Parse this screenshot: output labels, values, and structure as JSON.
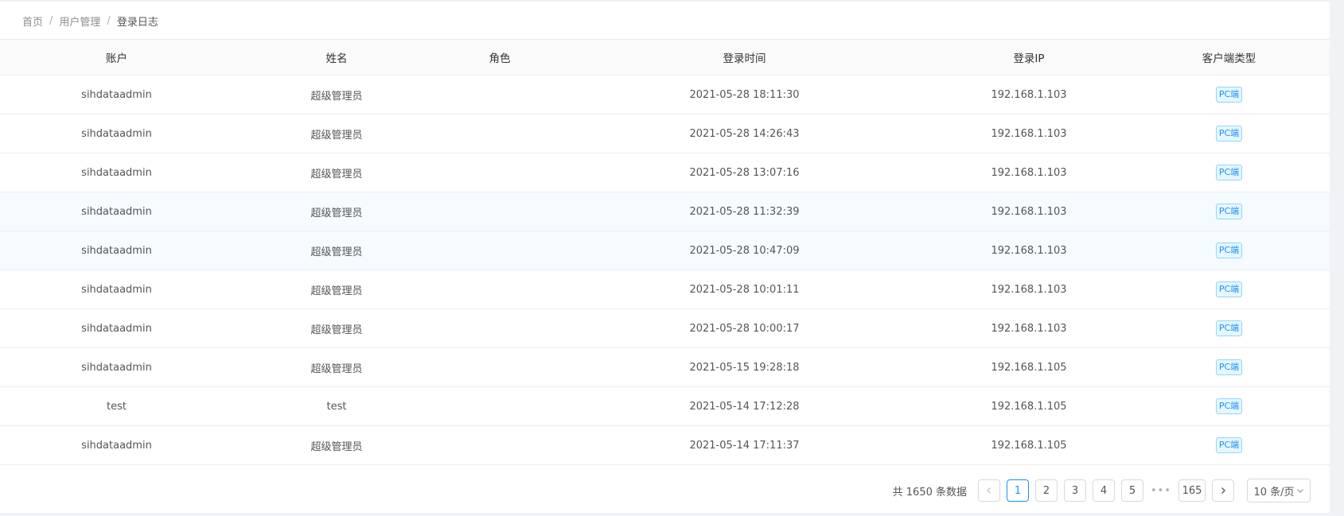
{
  "breadcrumb": {
    "items": [
      "首页",
      "用户管理",
      "登录日志"
    ],
    "separator": "/"
  },
  "table": {
    "columns": [
      "账户",
      "姓名",
      "角色",
      "登录时间",
      "登录IP",
      "客户端类型"
    ],
    "rows": [
      {
        "account": "sihdataadmin",
        "name": "超级管理员",
        "role": "",
        "time": "2021-05-28 18:11:30",
        "ip": "192.168.1.103",
        "client": "PC端"
      },
      {
        "account": "sihdataadmin",
        "name": "超级管理员",
        "role": "",
        "time": "2021-05-28 14:26:43",
        "ip": "192.168.1.103",
        "client": "PC端"
      },
      {
        "account": "sihdataadmin",
        "name": "超级管理员",
        "role": "",
        "time": "2021-05-28 13:07:16",
        "ip": "192.168.1.103",
        "client": "PC端"
      },
      {
        "account": "sihdataadmin",
        "name": "超级管理员",
        "role": "",
        "time": "2021-05-28 11:32:39",
        "ip": "192.168.1.103",
        "client": "PC端"
      },
      {
        "account": "sihdataadmin",
        "name": "超级管理员",
        "role": "",
        "time": "2021-05-28 10:47:09",
        "ip": "192.168.1.103",
        "client": "PC端"
      },
      {
        "account": "sihdataadmin",
        "name": "超级管理员",
        "role": "",
        "time": "2021-05-28 10:01:11",
        "ip": "192.168.1.103",
        "client": "PC端"
      },
      {
        "account": "sihdataadmin",
        "name": "超级管理员",
        "role": "",
        "time": "2021-05-28 10:00:17",
        "ip": "192.168.1.103",
        "client": "PC端"
      },
      {
        "account": "sihdataadmin",
        "name": "超级管理员",
        "role": "",
        "time": "2021-05-15 19:28:18",
        "ip": "192.168.1.105",
        "client": "PC端"
      },
      {
        "account": "test",
        "name": "test",
        "role": "",
        "time": "2021-05-14 17:12:28",
        "ip": "192.168.1.105",
        "client": "PC端"
      },
      {
        "account": "sihdataadmin",
        "name": "超级管理员",
        "role": "",
        "time": "2021-05-14 17:11:37",
        "ip": "192.168.1.105",
        "client": "PC端"
      }
    ],
    "highlighted_rows": [
      3,
      4
    ]
  },
  "pagination": {
    "total_text": "共 1650 条数据",
    "prev_icon": "chevron-left-icon",
    "next_icon": "chevron-right-icon",
    "pages": [
      "1",
      "2",
      "3",
      "4",
      "5"
    ],
    "current_page": "1",
    "ellipsis": "•••",
    "last_page": "165",
    "page_size": "10 条/页"
  },
  "colors": {
    "accent": "#1890ff",
    "tag_bg": "#e6f7ff",
    "tag_border": "#91d5ff",
    "row_highlight": "#f5fbff"
  }
}
